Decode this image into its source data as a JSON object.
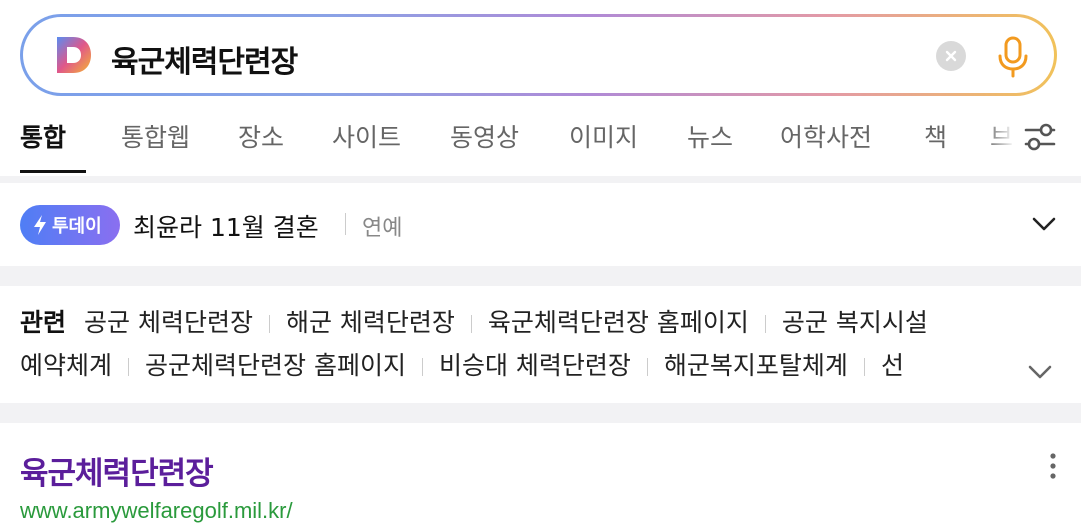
{
  "search": {
    "query": "육군체력단련장",
    "logo_letter": "D"
  },
  "tabs": [
    {
      "label": "통합",
      "active": true
    },
    {
      "label": "통합웹",
      "active": false
    },
    {
      "label": "장소",
      "active": false
    },
    {
      "label": "사이트",
      "active": false
    },
    {
      "label": "동영상",
      "active": false
    },
    {
      "label": "이미지",
      "active": false
    },
    {
      "label": "뉴스",
      "active": false
    },
    {
      "label": "어학사전",
      "active": false
    },
    {
      "label": "책",
      "active": false
    },
    {
      "label": "브",
      "active": false
    }
  ],
  "today": {
    "badge": "투데이",
    "headline": "최윤라 11월 결혼",
    "category": "연예"
  },
  "related": {
    "heading": "관련",
    "items": [
      "공군 체력단련장",
      "해군 체력단련장",
      "육군체력단련장 홈페이지",
      "공군 복지시설",
      "예약체계",
      "공군체력단련장 홈페이지",
      "비승대 체력단련장",
      "해군복지포탈체계",
      "선"
    ]
  },
  "result": {
    "title": "육군체력단련장",
    "url": "www.armywelfaregolf.mil.kr/"
  },
  "colors": {
    "title_purple": "#5b1e9b",
    "url_green": "#2a9a3c",
    "mic_orange": "#f29a1f",
    "badge_blue": "#4f7ef5"
  }
}
